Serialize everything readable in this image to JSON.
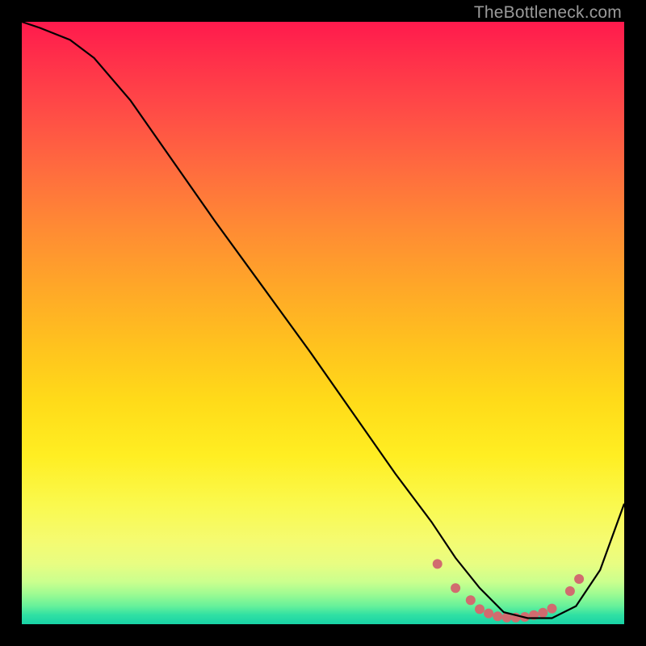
{
  "watermark": "TheBottleneck.com",
  "chart_data": {
    "type": "line",
    "title": "",
    "xlabel": "",
    "ylabel": "",
    "xlim": [
      0,
      100
    ],
    "ylim": [
      0,
      100
    ],
    "grid": false,
    "legend": false,
    "series": [
      {
        "name": "bottleneck-curve",
        "x": [
          0,
          3,
          8,
          12,
          18,
          25,
          32,
          40,
          48,
          55,
          62,
          68,
          72,
          76,
          80,
          84,
          88,
          92,
          96,
          100
        ],
        "y": [
          100,
          99,
          97,
          94,
          87,
          77,
          67,
          56,
          45,
          35,
          25,
          17,
          11,
          6,
          2,
          1,
          1,
          3,
          9,
          20
        ]
      }
    ],
    "markers": {
      "name": "flat-region-dots",
      "x": [
        69,
        72,
        74.5,
        76,
        77.5,
        79,
        80.5,
        82,
        83.5,
        85,
        86.5,
        88,
        91,
        92.5
      ],
      "y": [
        10,
        6,
        4,
        2.5,
        1.8,
        1.3,
        1.1,
        1.1,
        1.2,
        1.5,
        1.9,
        2.6,
        5.5,
        7.5
      ],
      "color": "#d16b6f",
      "radius": 6
    },
    "background_gradient": {
      "stops": [
        {
          "pos": 0,
          "color": "#ff1a4d"
        },
        {
          "pos": 0.5,
          "color": "#ffc31e"
        },
        {
          "pos": 0.85,
          "color": "#f5fb70"
        },
        {
          "pos": 1.0,
          "color": "#18d2a6"
        }
      ]
    }
  }
}
